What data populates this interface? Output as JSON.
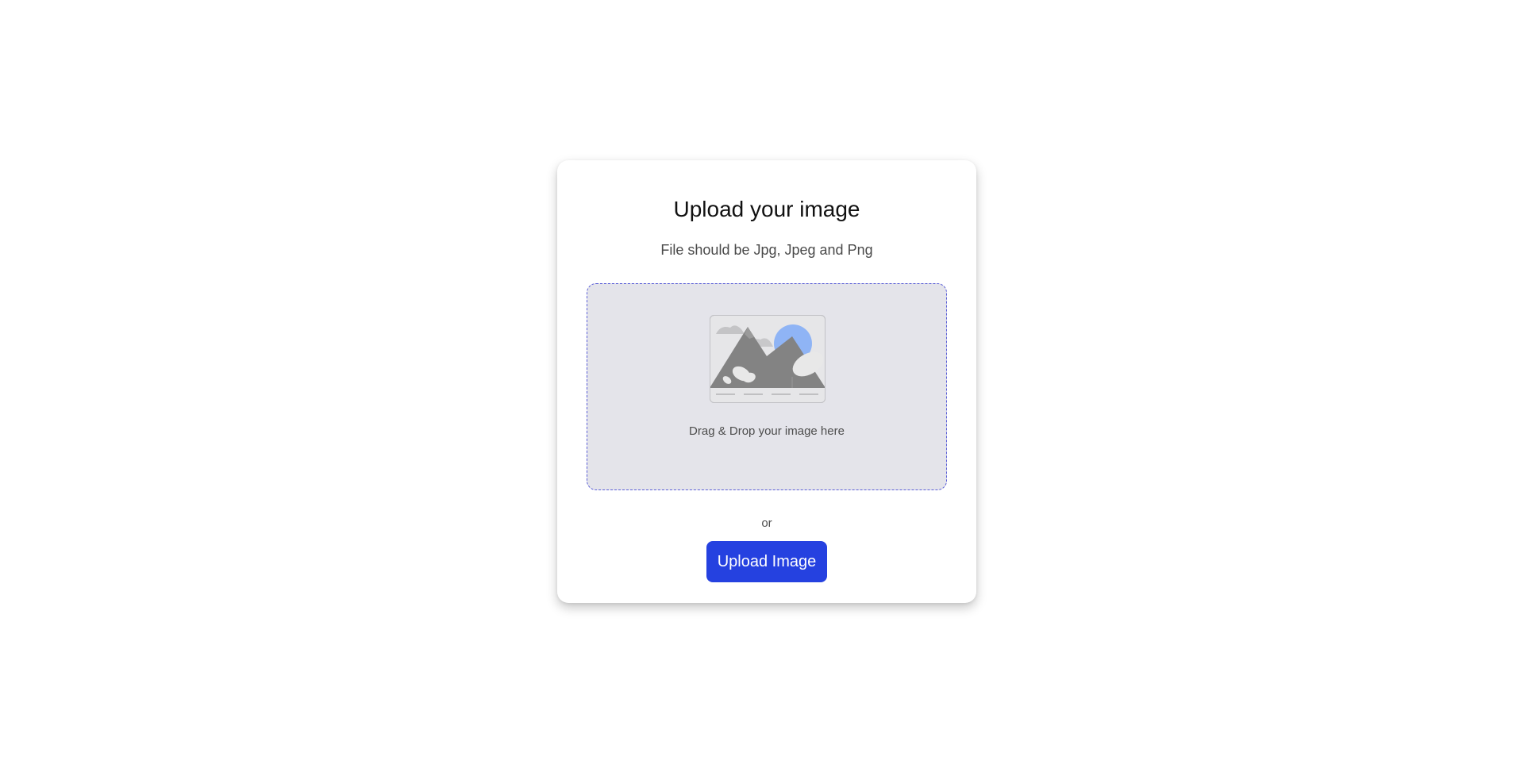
{
  "upload_card": {
    "title": "Upload your image",
    "subtitle": "File should be Jpg, Jpeg and Png",
    "dropzone": {
      "icon": "image-placeholder-icon",
      "text": "Drag & Drop your image here"
    },
    "separator": "or",
    "upload_button_label": "Upload Image"
  },
  "colors": {
    "primary": "#2541e0",
    "dropzone_bg": "#e4e4ea",
    "dropzone_border": "#5b5fd8",
    "sun": "#8fb4f5"
  }
}
